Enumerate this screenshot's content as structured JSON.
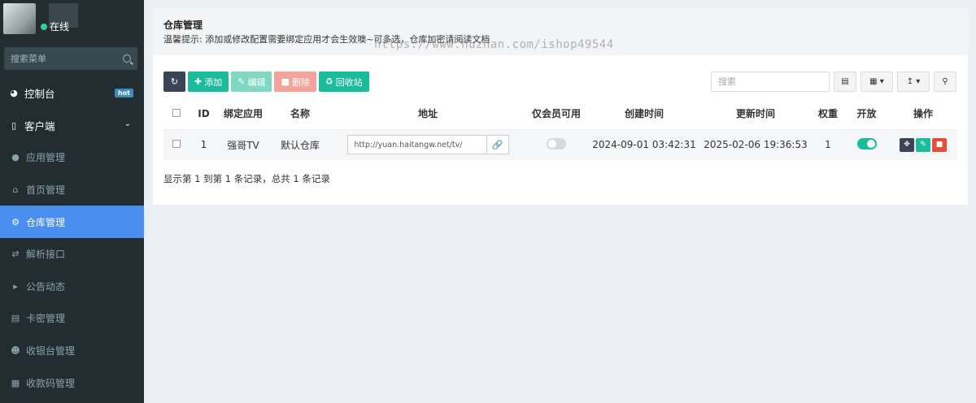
{
  "sidebar": {
    "status": "在线",
    "search_placeholder": "搜索菜单",
    "items": [
      {
        "label": "控制台",
        "icon": "dashboard-icon",
        "badge": "hot",
        "type": "top"
      },
      {
        "label": "客户端",
        "icon": "drive-icon",
        "type": "top"
      },
      {
        "label": "应用管理",
        "icon": "android-icon",
        "type": "sub"
      },
      {
        "label": "首页管理",
        "icon": "home-icon",
        "type": "sub"
      },
      {
        "label": "仓库管理",
        "icon": "cogs-icon",
        "type": "sub",
        "active": true
      },
      {
        "label": "解析接口",
        "icon": "usb-icon",
        "type": "sub"
      },
      {
        "label": "公告动态",
        "icon": "bullhorn-icon",
        "type": "sub"
      },
      {
        "label": "卡密管理",
        "icon": "id-card-icon",
        "type": "sub"
      },
      {
        "label": "收银台管理",
        "icon": "user-plus-icon",
        "type": "sub"
      },
      {
        "label": "收款码管理",
        "icon": "qrcode-icon",
        "type": "sub"
      }
    ]
  },
  "header": {
    "title": "仓库管理",
    "tip": "温馨提示: 添加或修改配置需要绑定应用才会生效噢~可多选，仓库加密请阅读文档",
    "watermark": "https://www.huzhan.com/ishop49544"
  },
  "toolbar": {
    "add": "添加",
    "edit": "编辑",
    "delete": "删除",
    "recycle": "回收站",
    "search_placeholder": "搜索"
  },
  "table": {
    "columns": [
      "ID",
      "绑定应用",
      "名称",
      "地址",
      "仅会员可用",
      "创建时间",
      "更新时间",
      "权重",
      "开放",
      "操作"
    ],
    "rows": [
      {
        "id": "1",
        "app": "强哥TV",
        "name": "默认仓库",
        "url": "http://yuan.haitangw.net/tv/",
        "member_only": false,
        "created": "2024-09-01 03:42:31",
        "updated": "2025-02-06 19:36:53",
        "weight": "1",
        "open": true
      }
    ]
  },
  "summary": "显示第 1 到第 1 条记录，总共 1 条记录",
  "colors": {
    "sidebar_bg": "#222d32",
    "active": "#4a8ff0",
    "success": "#1abc9c",
    "danger": "#e74c3c",
    "dark": "#3b4357"
  }
}
